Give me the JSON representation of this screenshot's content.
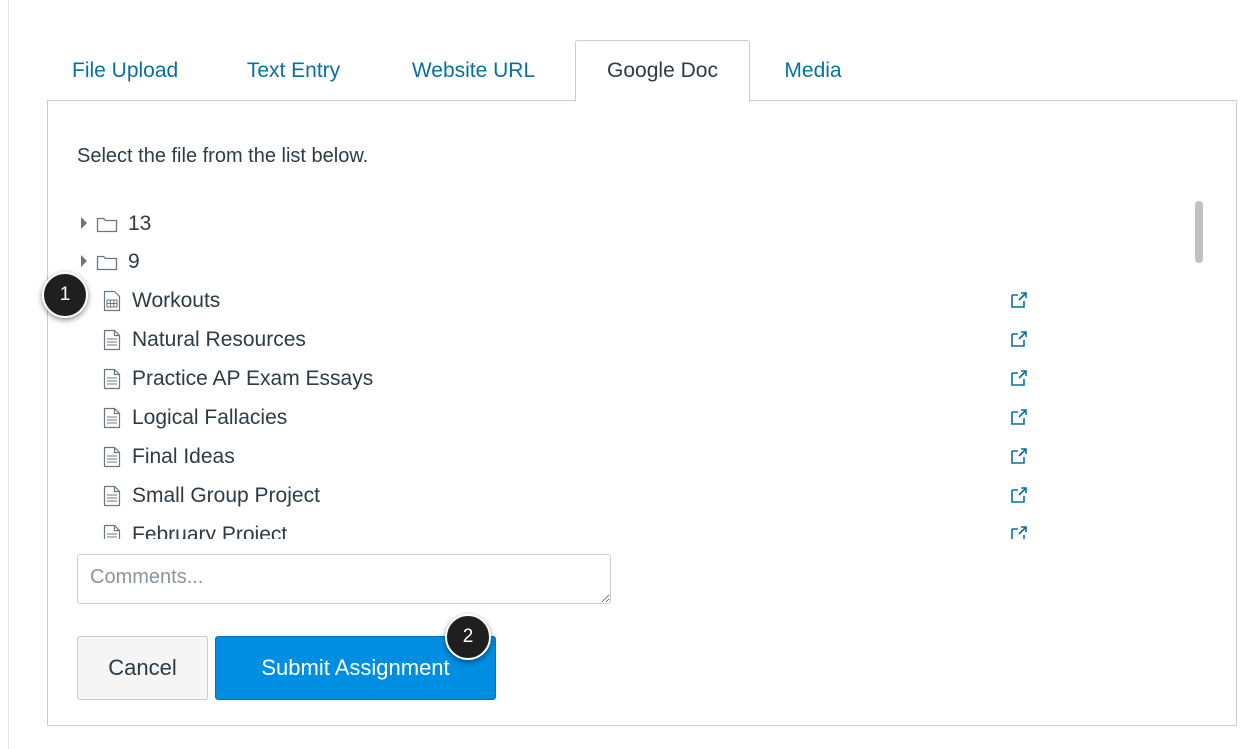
{
  "tabs": [
    {
      "label": "File Upload",
      "active": false
    },
    {
      "label": "Text Entry",
      "active": false
    },
    {
      "label": "Website URL",
      "active": false
    },
    {
      "label": "Google Doc",
      "active": true
    },
    {
      "label": "Media",
      "active": false
    }
  ],
  "panel": {
    "instruction": "Select the file from the list below.",
    "files": [
      {
        "type": "folder",
        "label": "13",
        "icon": "folder-icon"
      },
      {
        "type": "folder",
        "label": "9",
        "icon": "folder-icon"
      },
      {
        "type": "spreadsheet",
        "label": "Workouts",
        "icon": "spreadsheet-icon"
      },
      {
        "type": "document",
        "label": "Natural Resources",
        "icon": "document-icon"
      },
      {
        "type": "document",
        "label": "Practice AP Exam Essays",
        "icon": "document-icon"
      },
      {
        "type": "document",
        "label": "Logical Fallacies",
        "icon": "document-icon"
      },
      {
        "type": "document",
        "label": "Final Ideas",
        "icon": "document-icon"
      },
      {
        "type": "document",
        "label": "Small Group Project",
        "icon": "document-icon"
      },
      {
        "type": "document",
        "label": "February Project",
        "icon": "document-icon"
      }
    ],
    "comments_placeholder": "Comments...",
    "comments_value": "",
    "cancel_label": "Cancel",
    "submit_label": "Submit Assignment"
  },
  "callouts": [
    {
      "label": "1"
    },
    {
      "label": "2"
    }
  ],
  "colors": {
    "link": "#0770a3",
    "primary_button": "#008ee2",
    "text": "#2d3b45",
    "border": "#c7cdd1",
    "callout": "#1f1f1f"
  }
}
